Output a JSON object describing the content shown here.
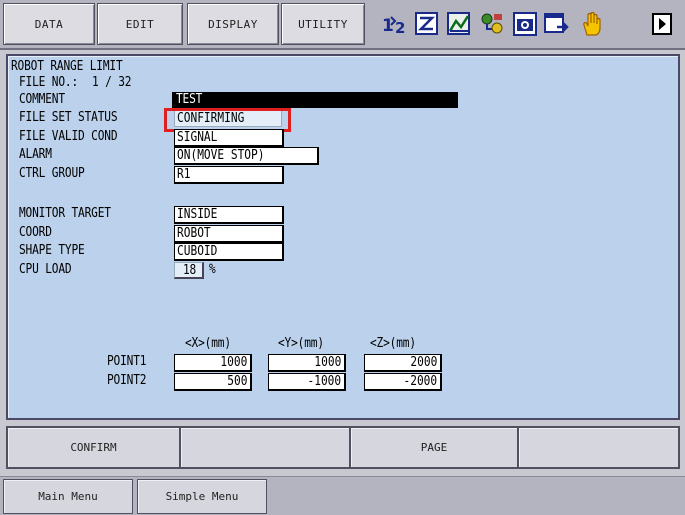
{
  "menu": {
    "data": "DATA",
    "edit": "EDIT",
    "display": "DISPLAY",
    "utility": "UTILITY"
  },
  "toolbar_icons": [
    "numbering-icon",
    "edit-box-icon",
    "graph-icon",
    "network-icon",
    "camera-icon",
    "window-arrow-icon",
    "hand-icon",
    "play-icon"
  ],
  "screen": {
    "title": "ROBOT RANGE LIMIT",
    "file_no_label": "FILE NO.:",
    "file_no_value": "1 / 32",
    "comment_label": "COMMENT",
    "comment_value": "TEST",
    "file_set_status_label": "FILE SET STATUS",
    "file_set_status_value": "CONFIRMING",
    "file_valid_cond_label": "FILE VALID COND",
    "file_valid_cond_value": "SIGNAL",
    "alarm_label": "ALARM",
    "alarm_value": "ON(MOVE STOP)",
    "ctrl_group_label": "CTRL GROUP",
    "ctrl_group_value": "R1",
    "monitor_target_label": "MONITOR TARGET",
    "monitor_target_value": "INSIDE",
    "coord_label": "COORD",
    "coord_value": "ROBOT",
    "shape_type_label": "SHAPE TYPE",
    "shape_type_value": "CUBOID",
    "cpu_load_label": "CPU LOAD",
    "cpu_load_value": "18",
    "cpu_load_unit": "%",
    "columns": [
      "<X>(mm)",
      "<Y>(mm)",
      "<Z>(mm)"
    ],
    "points": [
      {
        "label": "POINT1",
        "x": "1000",
        "y": "1000",
        "z": "2000"
      },
      {
        "label": "POINT2",
        "x": "500",
        "y": "-1000",
        "z": "-2000"
      }
    ]
  },
  "function_keys": {
    "f1": "CONFIRM",
    "f2": "",
    "f3": "PAGE",
    "f4": ""
  },
  "bottom": {
    "main_menu": "Main Menu",
    "simple_menu": "Simple Menu"
  },
  "colors": {
    "panel_bg": "#bcd2ec",
    "highlight": "#e02020",
    "comment_bar": "#000000"
  }
}
